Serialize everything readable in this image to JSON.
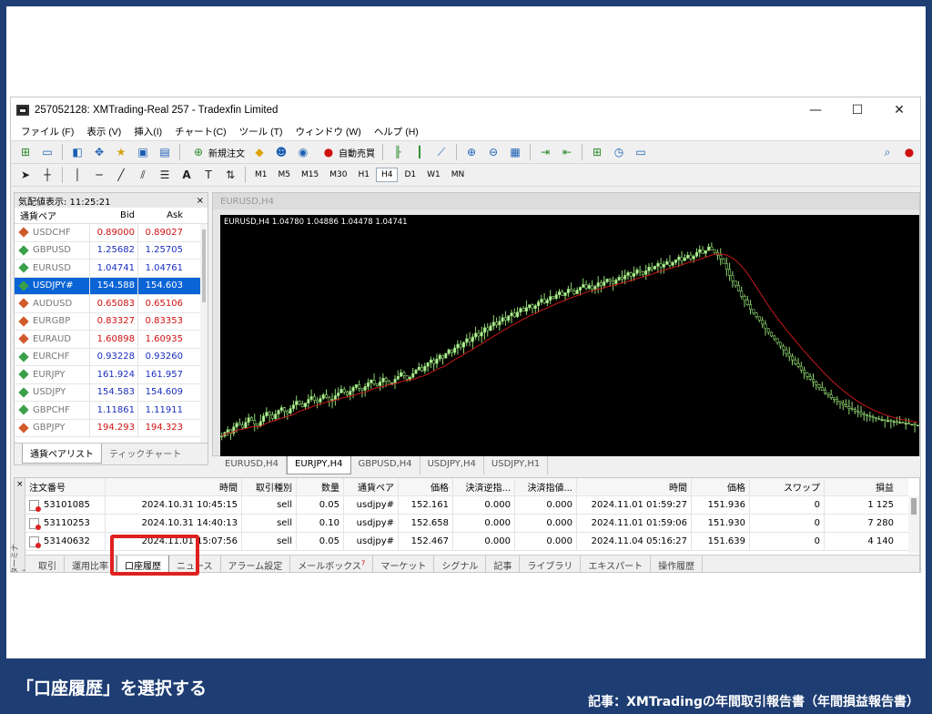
{
  "window": {
    "title": "257052128: XMTrading-Real 257 - Tradexfin Limited",
    "minimize": "—",
    "maximize": "☐",
    "close": "✕"
  },
  "menu": [
    "ファイル (F)",
    "表示 (V)",
    "挿入(I)",
    "チャート(C)",
    "ツール (T)",
    "ウィンドウ (W)",
    "ヘルプ (H)"
  ],
  "toolbar": {
    "new_order": "新規注文",
    "auto_trade": "自動売買",
    "text_tool": "A"
  },
  "timeframes": [
    "M1",
    "M5",
    "M15",
    "M30",
    "H1",
    "H4",
    "D1",
    "W1",
    "MN"
  ],
  "timeframe_selected": "H4",
  "market_watch": {
    "header": "気配値表示: 11:25:21",
    "close": "×",
    "col_symbol": "通貨ペア",
    "col_bid": "Bid",
    "col_ask": "Ask",
    "rows": [
      {
        "symbol": "USDCHF",
        "bid": "0.89000",
        "ask": "0.89027",
        "dir": "dn",
        "color": "red"
      },
      {
        "symbol": "GBPUSD",
        "bid": "1.25682",
        "ask": "1.25705",
        "dir": "up",
        "color": "blue"
      },
      {
        "symbol": "EURUSD",
        "bid": "1.04741",
        "ask": "1.04761",
        "dir": "up",
        "color": "blue"
      },
      {
        "symbol": "USDJPY#",
        "bid": "154.588",
        "ask": "154.603",
        "dir": "up",
        "color": "blue"
      },
      {
        "symbol": "AUDUSD",
        "bid": "0.65083",
        "ask": "0.65106",
        "dir": "dn",
        "color": "red"
      },
      {
        "symbol": "EURGBP",
        "bid": "0.83327",
        "ask": "0.83353",
        "dir": "dn",
        "color": "red"
      },
      {
        "symbol": "EURAUD",
        "bid": "1.60898",
        "ask": "1.60935",
        "dir": "dn",
        "color": "red"
      },
      {
        "symbol": "EURCHF",
        "bid": "0.93228",
        "ask": "0.93260",
        "dir": "up",
        "color": "blue"
      },
      {
        "symbol": "EURJPY",
        "bid": "161.924",
        "ask": "161.957",
        "dir": "up",
        "color": "blue"
      },
      {
        "symbol": "USDJPY",
        "bid": "154.583",
        "ask": "154.609",
        "dir": "up",
        "color": "blue"
      },
      {
        "symbol": "GBPCHF",
        "bid": "1.11861",
        "ask": "1.11911",
        "dir": "up",
        "color": "blue"
      },
      {
        "symbol": "GBPJPY",
        "bid": "194.293",
        "ask": "194.323",
        "dir": "dn",
        "color": "red"
      }
    ],
    "selected_index": 3,
    "tabs": [
      "通貨ペアリスト",
      "ティックチャート"
    ]
  },
  "chart": {
    "window_title": "EURUSD,H4",
    "info": "EURUSD,H4  1.04780 1.04886 1.04478 1.04741",
    "tabs": [
      "EURUSD,H4",
      "EURJPY,H4",
      "GBPUSD,H4",
      "USDJPY,H4",
      "USDJPY,H1"
    ],
    "active_tab": 1,
    "closes": [
      48,
      52,
      55,
      51,
      58,
      62,
      60,
      57,
      63,
      68,
      65,
      61,
      59,
      64,
      70,
      74,
      71,
      67,
      72,
      76,
      79,
      75,
      73,
      78,
      82,
      86,
      83,
      80,
      84,
      88,
      91,
      87,
      85,
      89,
      93,
      90,
      86,
      88,
      92,
      95,
      99,
      96,
      93,
      97,
      101,
      104,
      100,
      98,
      102,
      106,
      109,
      105,
      103,
      107,
      111,
      108,
      104,
      106,
      110,
      113,
      117,
      114,
      110,
      112,
      116,
      120,
      123,
      119,
      124,
      128,
      131,
      127,
      132,
      136,
      133,
      138,
      142,
      139,
      144,
      148,
      145,
      150,
      154,
      151,
      156,
      160,
      157,
      161,
      166,
      163,
      168,
      172,
      169,
      173,
      177,
      174,
      179,
      182,
      178,
      183,
      187,
      184,
      188,
      191,
      187,
      190,
      194,
      197,
      193,
      196,
      200,
      198,
      202,
      205,
      201,
      204,
      208,
      206,
      203,
      207,
      210,
      213,
      209,
      212,
      208,
      211,
      215,
      212,
      216,
      219,
      217,
      214,
      218,
      221,
      219,
      223,
      226,
      222,
      225,
      229,
      227,
      224,
      228,
      232,
      230,
      233,
      236,
      232,
      235,
      238,
      234,
      237,
      240,
      243,
      239,
      242,
      245,
      241,
      244,
      248,
      251,
      247,
      250,
      254,
      251,
      248,
      245,
      241,
      236,
      230,
      223,
      217,
      212,
      206,
      200,
      196,
      191,
      186,
      182,
      178,
      174,
      170,
      165,
      161,
      157,
      154,
      150,
      146,
      142,
      138,
      135,
      131,
      127,
      124,
      120,
      117,
      113,
      110,
      107,
      104,
      101,
      98,
      95,
      93,
      90,
      88,
      86,
      84,
      82,
      80,
      78,
      77,
      75,
      74,
      72,
      71,
      70,
      69,
      68,
      67,
      66,
      66,
      65,
      65,
      64,
      64,
      63,
      63,
      62,
      62,
      61,
      61,
      60,
      60
    ]
  },
  "terminal": {
    "side_label": "ターミナル",
    "close": "×",
    "headers": [
      "注文番号",
      "時間",
      "取引種別",
      "数量",
      "通貨ペア",
      "価格",
      "決済逆指...",
      "決済指値...",
      "時間",
      "価格",
      "スワップ",
      "損益"
    ],
    "rows": [
      [
        "53101085",
        "2024.10.31 10:45:15",
        "sell",
        "0.05",
        "usdjpy#",
        "152.161",
        "0.000",
        "0.000",
        "2024.11.01 01:59:27",
        "151.936",
        "0",
        "1 125"
      ],
      [
        "53110253",
        "2024.10.31 14:40:13",
        "sell",
        "0.10",
        "usdjpy#",
        "152.658",
        "0.000",
        "0.000",
        "2024.11.01 01:59:06",
        "151.930",
        "0",
        "7 280"
      ],
      [
        "53140632",
        "2024.11.01 15:07:56",
        "sell",
        "0.05",
        "usdjpy#",
        "152.467",
        "0.000",
        "0.000",
        "2024.11.04 05:16:27",
        "151.639",
        "0",
        "4 140"
      ]
    ],
    "tabs": [
      "取引",
      "運用比率",
      "口座履歴",
      "ニュース",
      "アラーム設定",
      "メールボックス",
      "マーケット",
      "シグナル",
      "記事",
      "ライブラリ",
      "エキスパート",
      "操作履歴"
    ],
    "mailbox_badge": "7",
    "active_tab": 2
  },
  "caption": "「口座履歴」を選択する",
  "credit": "記事：XMTradingの年間取引報告書（年間損益報告書）",
  "colors": {
    "background": "#1d3d73",
    "highlight": "#e02020",
    "candle_bull": "#b8f0a0",
    "ma_line": "#c81818"
  }
}
